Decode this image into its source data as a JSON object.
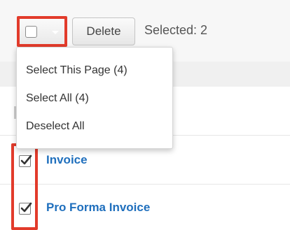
{
  "toolbar": {
    "delete_label": "Delete",
    "selected_text": "Selected: 2"
  },
  "dropdown": {
    "items": [
      {
        "label": "Select This Page (4)"
      },
      {
        "label": "Select All (4)"
      },
      {
        "label": "Deselect All"
      }
    ]
  },
  "rows": [
    {
      "label": "Invoice",
      "checked": true
    },
    {
      "label": "Pro Forma Invoice",
      "checked": true
    }
  ],
  "colors": {
    "highlight": "#e23b2b",
    "link": "#1f6fbd"
  },
  "icons": {
    "select_checkbox": "empty-checkbox-icon",
    "menu_caret": "chevron-down-icon",
    "row_checkbox": "checked-checkbox-icon"
  }
}
